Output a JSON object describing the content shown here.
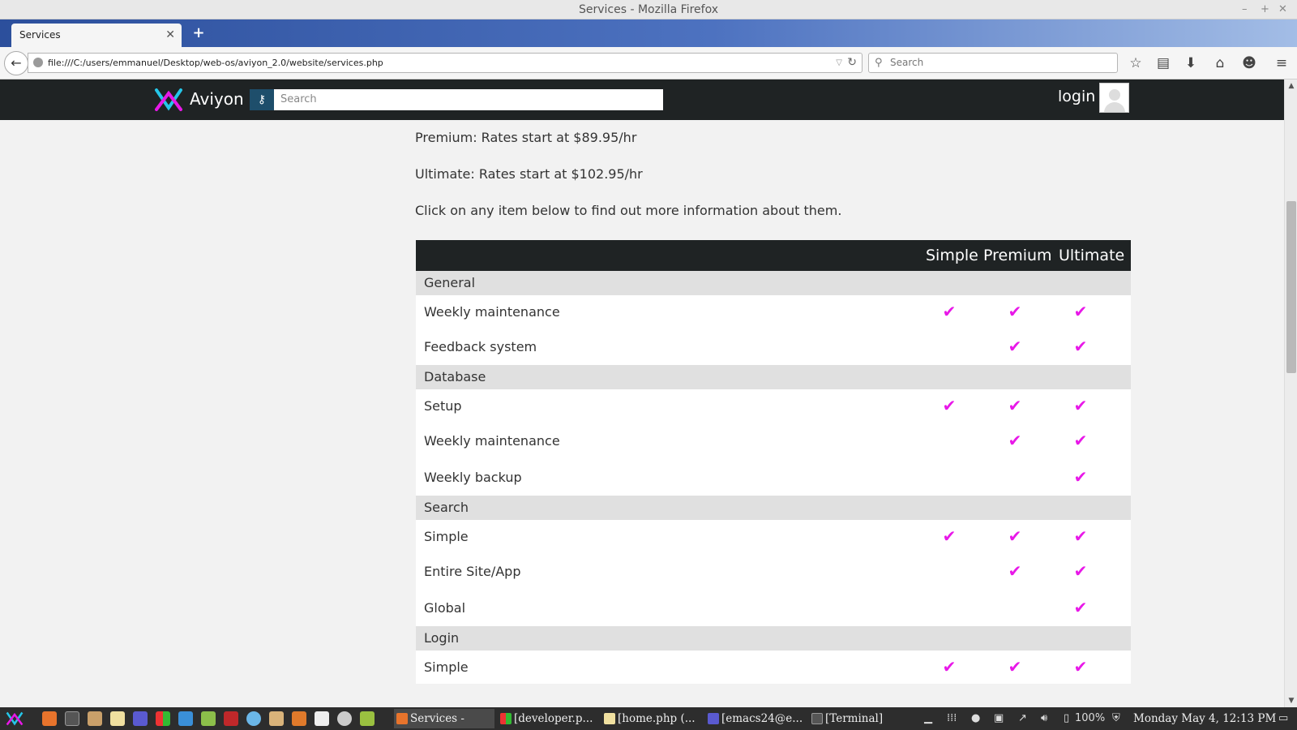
{
  "window": {
    "title": "Services - Mozilla Firefox"
  },
  "browser": {
    "tab_title": "Services",
    "url": "file:///C:/users/emmanuel/Desktop/web-os/aviyon_2.0/website/services.php",
    "search_placeholder": "Search"
  },
  "site": {
    "brand": "Aviyon",
    "search_placeholder": "Search",
    "login_label": "login"
  },
  "content": {
    "premium_rate": "Premium: Rates start at $89.95/hr",
    "ultimate_rate": "Ultimate: Rates start at $102.95/hr",
    "instructions": "Click on any item below to find out more information about them."
  },
  "table": {
    "columns": [
      "Simple",
      "Premium",
      "Ultimate"
    ],
    "check_symbol": "✔",
    "check_color": "#e818e8",
    "groups": [
      {
        "name": "General",
        "rows": [
          {
            "label": "Weekly maintenance",
            "simple": true,
            "premium": true,
            "ultimate": true
          },
          {
            "label": "Feedback system",
            "simple": false,
            "premium": true,
            "ultimate": true
          }
        ]
      },
      {
        "name": "Database",
        "rows": [
          {
            "label": "Setup",
            "simple": true,
            "premium": true,
            "ultimate": true
          },
          {
            "label": "Weekly maintenance",
            "simple": false,
            "premium": true,
            "ultimate": true
          },
          {
            "label": "Weekly backup",
            "simple": false,
            "premium": false,
            "ultimate": true
          }
        ]
      },
      {
        "name": "Search",
        "rows": [
          {
            "label": "Simple",
            "simple": true,
            "premium": true,
            "ultimate": true
          },
          {
            "label": "Entire Site/App",
            "simple": false,
            "premium": true,
            "ultimate": true
          },
          {
            "label": "Global",
            "simple": false,
            "premium": false,
            "ultimate": true
          }
        ]
      },
      {
        "name": "Login",
        "rows": [
          {
            "label": "Simple",
            "simple": true,
            "premium": true,
            "ultimate": true
          }
        ]
      }
    ]
  },
  "taskbar": {
    "tasks": [
      "Services - Mo...",
      "[developer.p...",
      "[home.php (...",
      "[emacs24@e...",
      "[Terminal]"
    ],
    "battery": "100%",
    "clock": "Monday May  4, 12:13 PM"
  },
  "colors": {
    "header_bg": "#1f2324",
    "accent": "#e818e8",
    "search_btn": "#1e4e6b"
  }
}
